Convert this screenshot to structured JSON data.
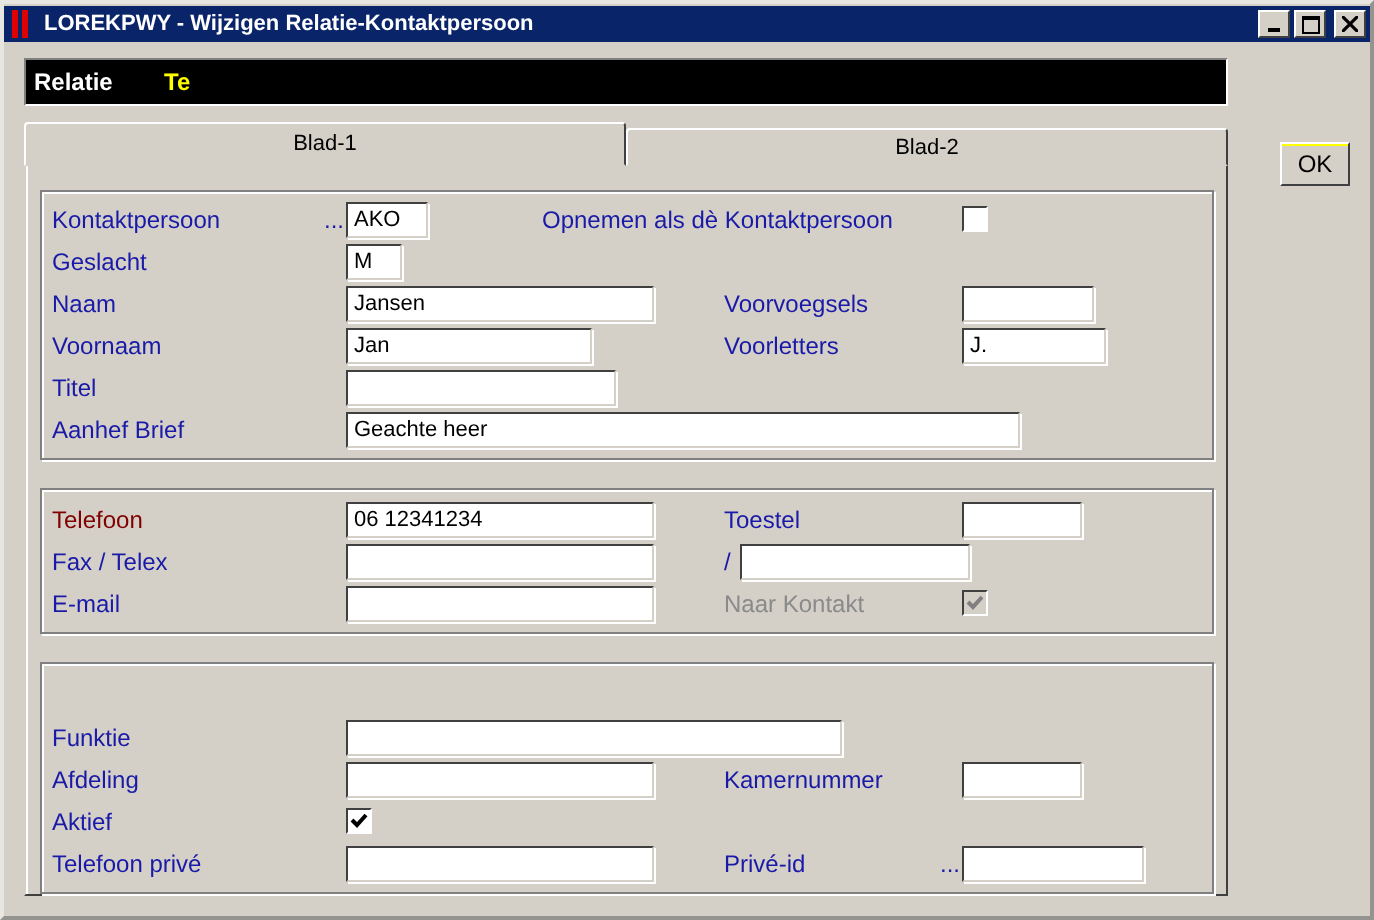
{
  "window": {
    "title": "LOREKPWY - Wijzigen Relatie-Kontaktpersoon"
  },
  "header": {
    "label": "Relatie",
    "value": "Te"
  },
  "tabs": [
    {
      "label": "Blad-1",
      "selected": true
    },
    {
      "label": "Blad-2",
      "selected": false
    }
  ],
  "sections": [
    {
      "rows": [
        {
          "left": {
            "label": "Kontaktpersoon",
            "required": false,
            "disabled": false,
            "dots": "...",
            "kind": "field",
            "value": "AKO"
          },
          "right": {
            "label": "Opnemen als dè Kontaktpersoon",
            "required": false,
            "disabled": false,
            "kind": "check",
            "checked": false
          }
        },
        {
          "left": {
            "label": "Geslacht",
            "required": false,
            "disabled": false,
            "kind": "field",
            "value": "M"
          }
        },
        {
          "left": {
            "label": "Naam",
            "required": false,
            "disabled": false,
            "kind": "field",
            "value": "Jansen"
          },
          "right": {
            "label": "Voorvoegsels",
            "required": false,
            "disabled": false,
            "kind": "field"
          }
        },
        {
          "left": {
            "label": "Voornaam",
            "required": false,
            "disabled": false,
            "kind": "field",
            "value": "Jan"
          },
          "right": {
            "label": "Voorletters",
            "required": false,
            "disabled": false,
            "kind": "field",
            "value": "J."
          }
        },
        {
          "left": {
            "label": "Titel",
            "required": false,
            "disabled": false,
            "kind": "field"
          }
        },
        {
          "left": {
            "label": "Aanhef Brief",
            "required": false,
            "disabled": false,
            "kind": "field",
            "value": "Geachte heer"
          }
        }
      ]
    },
    {
      "rows": [
        {
          "left": {
            "label": "Telefoon",
            "required": true,
            "disabled": false,
            "kind": "field",
            "value": "06 12341234"
          },
          "right": {
            "label": "Toestel",
            "required": false,
            "disabled": false,
            "kind": "field"
          }
        },
        {
          "left": {
            "label": "Fax / Telex",
            "required": false,
            "disabled": false,
            "kind": "field"
          },
          "right": {
            "label": "/",
            "required": false,
            "disabled": false,
            "kind": "field"
          }
        },
        {
          "left": {
            "label": "E-mail",
            "required": false,
            "disabled": false,
            "kind": "field"
          },
          "right": {
            "label": "Naar Kontakt",
            "required": false,
            "disabled": true,
            "kind": "check",
            "checked": true
          }
        }
      ]
    },
    {
      "rows": [
        {
          "left": {
            "label": "Funktie",
            "required": false,
            "disabled": false,
            "kind": "field"
          }
        },
        {
          "left": {
            "label": "Afdeling",
            "required": false,
            "disabled": false,
            "kind": "field"
          },
          "right": {
            "label": "Kamernummer",
            "required": false,
            "disabled": false,
            "kind": "field"
          }
        },
        {
          "left": {
            "label": "Aktief",
            "required": false,
            "disabled": false,
            "kind": "check",
            "checked": true
          }
        },
        {
          "left": {
            "label": "Telefoon privé",
            "required": false,
            "disabled": false,
            "kind": "field"
          },
          "right": {
            "label": "Privé-id",
            "required": false,
            "disabled": false,
            "dots": "...",
            "kind": "field"
          }
        }
      ]
    }
  ],
  "buttons": [
    {
      "label": "OK"
    }
  ]
}
